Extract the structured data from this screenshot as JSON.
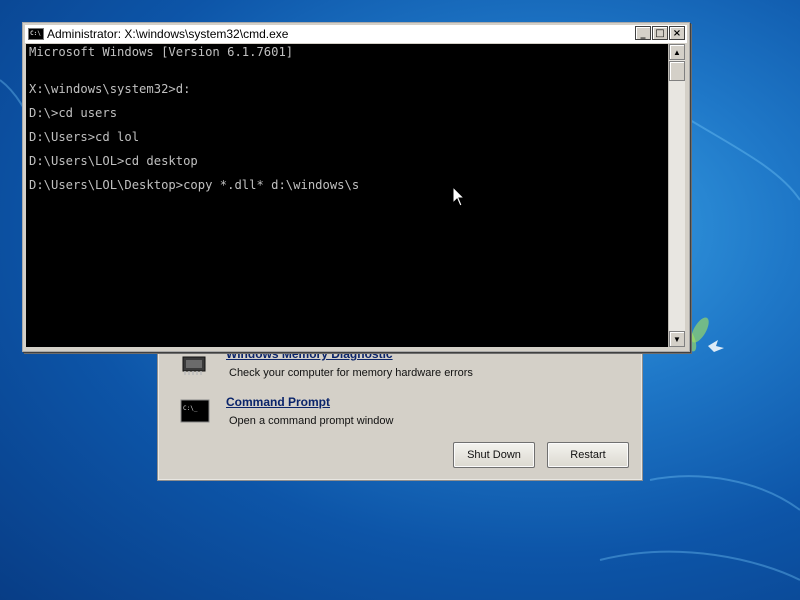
{
  "colors": {
    "wallpaper": "#1f78c8",
    "console_bg": "#000000",
    "console_fg": "#c0c0c0",
    "link": "#0a246a",
    "panel": "#d4d0c8"
  },
  "cmd_window": {
    "title": "Administrator: X:\\windows\\system32\\cmd.exe",
    "icon": "cmd-window-icon",
    "buttons": {
      "minimize": "_",
      "maximize": "□",
      "close": "×"
    },
    "lines": [
      "Microsoft Windows [Version 6.1.7601]",
      "X:\\windows\\system32>d:",
      "D:\\>cd users",
      "D:\\Users>cd lol",
      "D:\\Users\\LOL>cd desktop",
      "D:\\Users\\LOL\\Desktop>copy *.dll* d:\\windows\\s"
    ]
  },
  "recovery": {
    "items": [
      {
        "title": "Windows Memory Diagnostic",
        "description": "Check your computer for memory hardware errors",
        "icon": "memory-chip-icon"
      },
      {
        "title": "Command Prompt",
        "description": "Open a command prompt window",
        "icon": "command-prompt-icon"
      }
    ],
    "shutdown_label": "Shut Down",
    "restart_label": "Restart"
  }
}
